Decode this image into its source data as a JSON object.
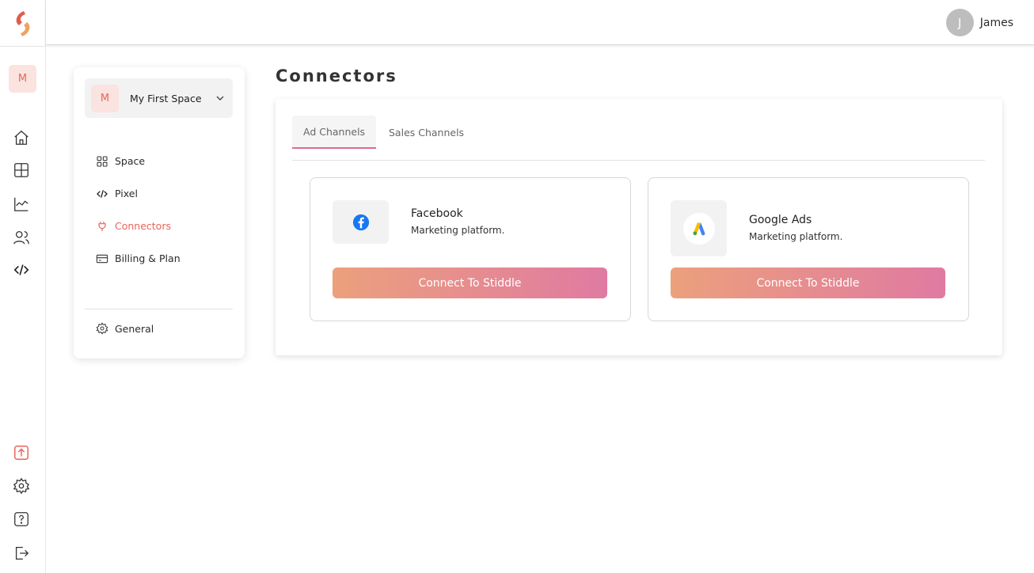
{
  "app": {
    "brand_colors": {
      "accent": "#e8645a",
      "gradient_start": "#eca07c",
      "gradient_end": "#e07aa2"
    }
  },
  "rail": {
    "space_initial": "M",
    "icons": [
      "home-icon",
      "dashboard-icon",
      "analytics-icon",
      "users-icon",
      "code-icon",
      "upload-icon",
      "settings-icon",
      "help-icon",
      "logout-icon"
    ]
  },
  "header": {
    "user_initial": "J",
    "user_name": "James"
  },
  "panel": {
    "space": {
      "initial": "M",
      "name": "My First Space"
    },
    "nav": [
      {
        "label": "Space",
        "icon": "grid-icon"
      },
      {
        "label": "Pixel",
        "icon": "code-icon"
      },
      {
        "label": "Connectors",
        "icon": "plug-icon",
        "active": true
      },
      {
        "label": "Billing & Plan",
        "icon": "card-icon"
      }
    ],
    "general": {
      "label": "General",
      "icon": "gear-icon"
    }
  },
  "main": {
    "title": "Connectors",
    "tabs": [
      {
        "label": "Ad Channels",
        "active": true
      },
      {
        "label": "Sales Channels",
        "active": false
      }
    ],
    "connectors": [
      {
        "name": "Facebook",
        "description": "Marketing platform.",
        "button": "Connect To Stiddle",
        "icon": "facebook-icon"
      },
      {
        "name": "Google Ads",
        "description": "Marketing platform.",
        "button": "Connect To Stiddle",
        "icon": "google-ads-icon"
      }
    ]
  }
}
